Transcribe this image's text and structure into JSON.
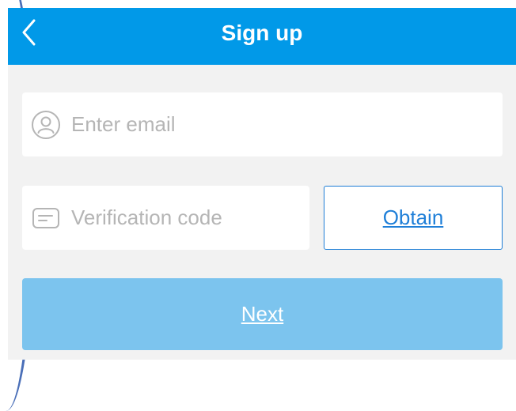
{
  "header": {
    "title": "Sign up",
    "back_icon": "chevron-left-icon"
  },
  "form": {
    "email": {
      "placeholder": "Enter email",
      "value": "",
      "icon": "user-circle-icon"
    },
    "code": {
      "placeholder": "Verification code",
      "value": "",
      "icon": "message-card-icon"
    },
    "obtain_label": "Obtain",
    "next_label": "Next"
  },
  "colors": {
    "header_bg": "#0199e8",
    "page_bg": "#f2f2f2",
    "next_bg": "#7cc4ee",
    "link_blue": "#1f7fd8",
    "placeholder": "#b5b5b5"
  }
}
